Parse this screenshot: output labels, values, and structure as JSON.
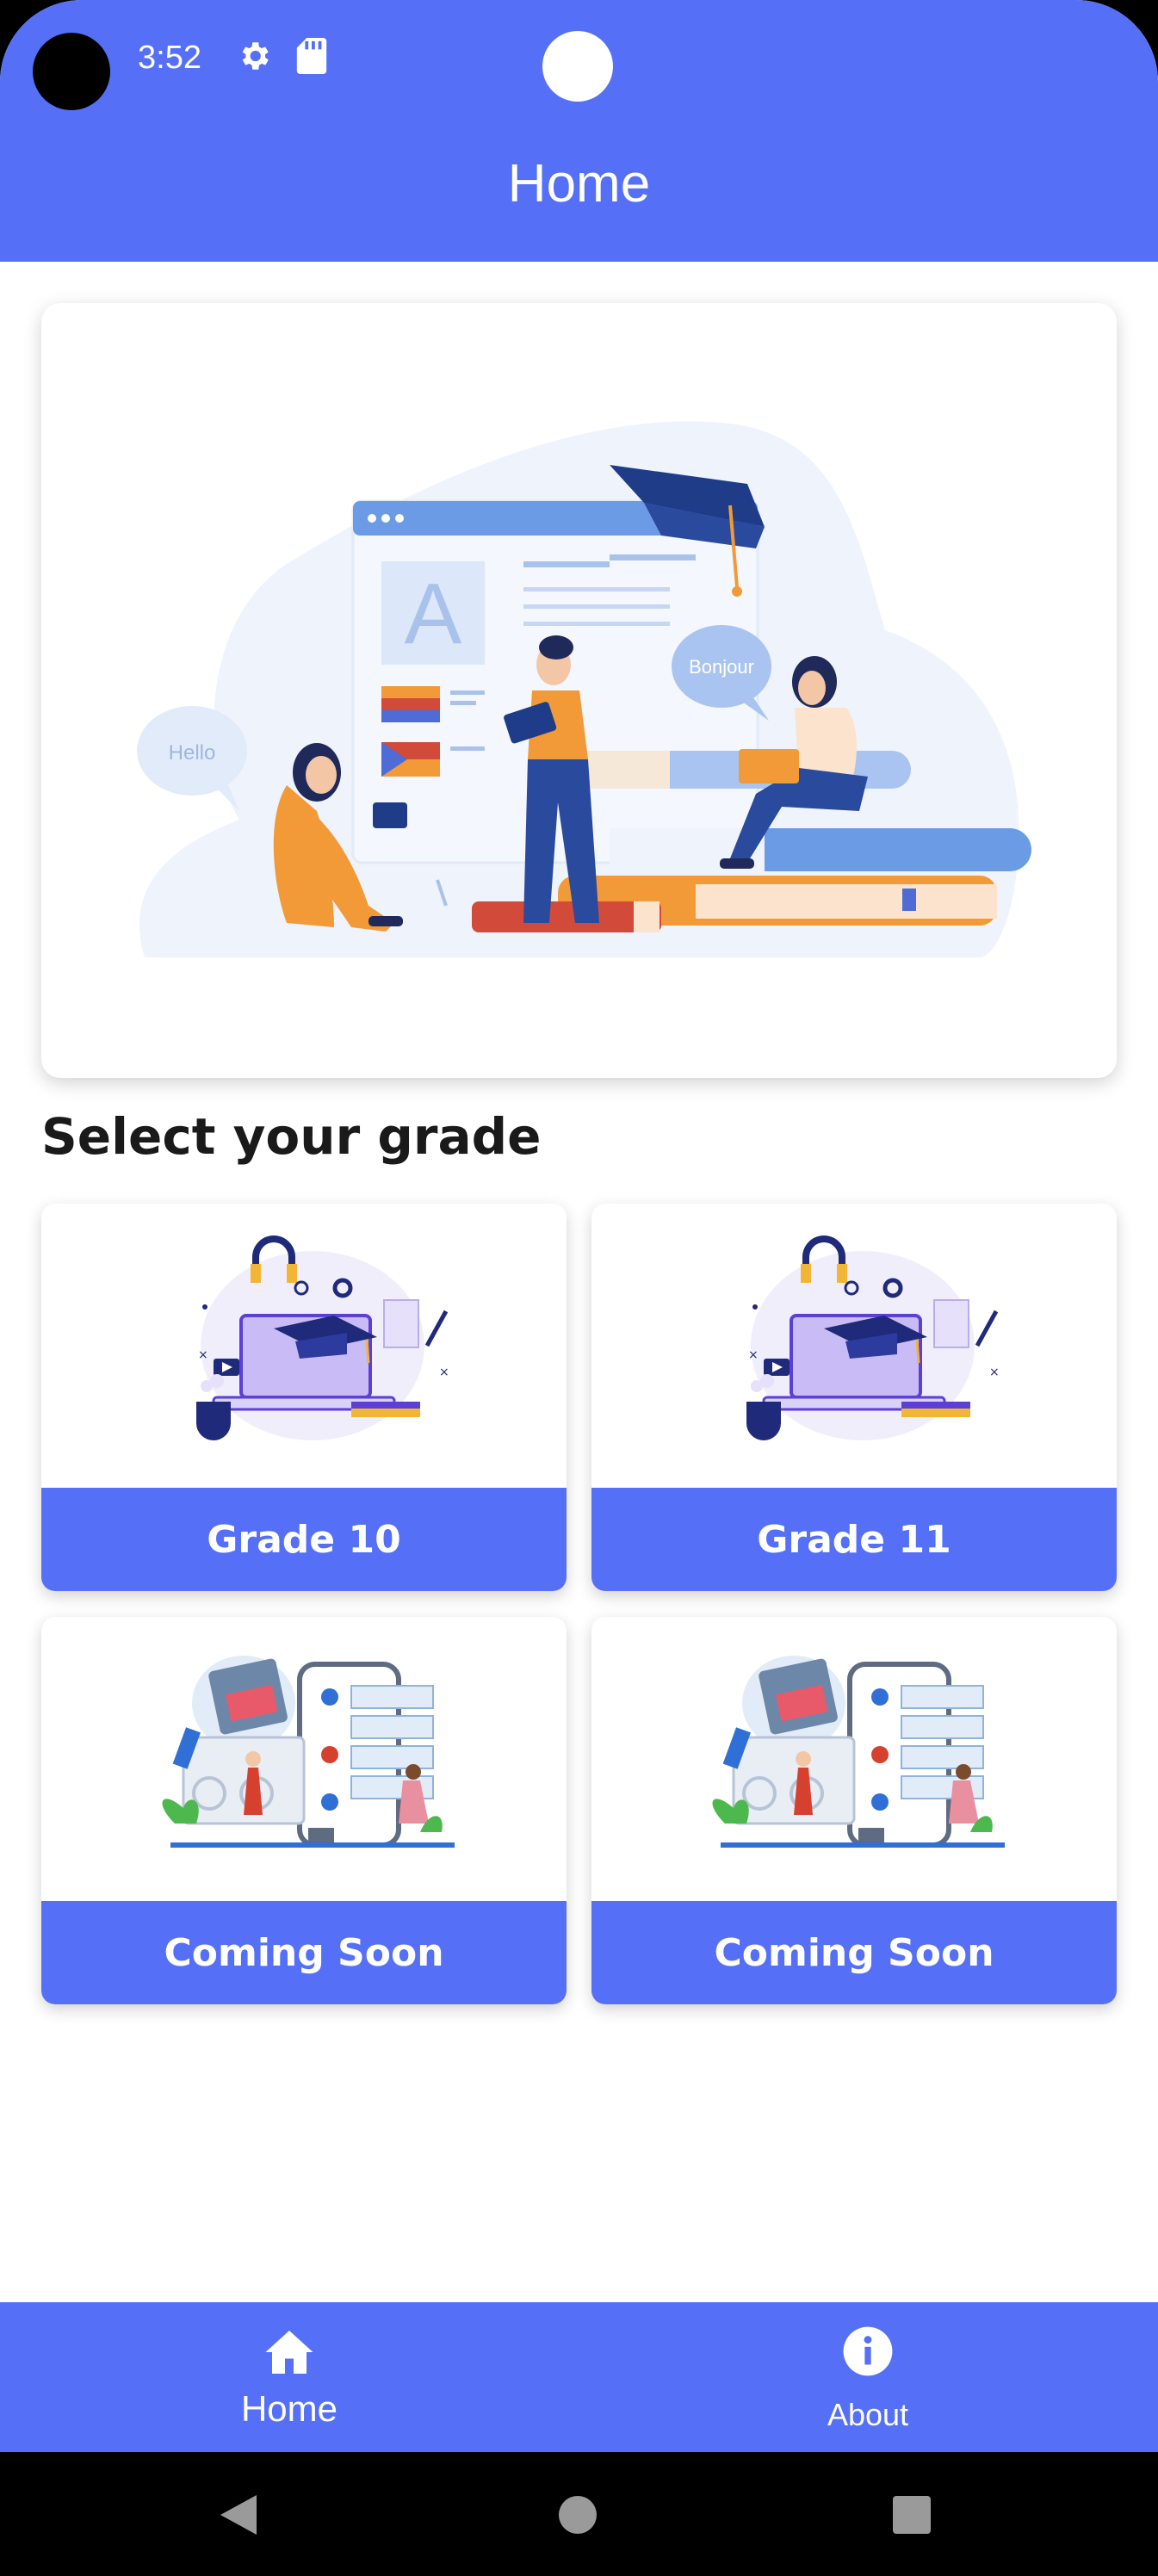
{
  "status_bar": {
    "time": "3:52",
    "icons": [
      "gear-icon",
      "sd-card-icon"
    ]
  },
  "header": {
    "title": "Home"
  },
  "hero": {
    "speech_left": "Hello",
    "speech_right": "Bonjour",
    "board_letter": "A"
  },
  "section": {
    "title": "Select your grade"
  },
  "grades": [
    {
      "label": "Grade 10",
      "image": "online-learning-illustration"
    },
    {
      "label": "Grade 11",
      "image": "online-learning-illustration"
    },
    {
      "label": "Coming Soon",
      "image": "mobile-app-illustration"
    },
    {
      "label": "Coming Soon",
      "image": "mobile-app-illustration"
    }
  ],
  "bottom_nav": {
    "items": [
      {
        "label": "Home",
        "icon": "home-icon",
        "active": true
      },
      {
        "label": "About",
        "icon": "info-icon",
        "active": false
      }
    ]
  },
  "system_nav": {
    "icons": [
      "back-icon",
      "home-circle-icon",
      "recents-icon"
    ]
  },
  "colors": {
    "primary": "#5570F6",
    "background": "#FFFFFF",
    "text": "#1A1A1A"
  }
}
